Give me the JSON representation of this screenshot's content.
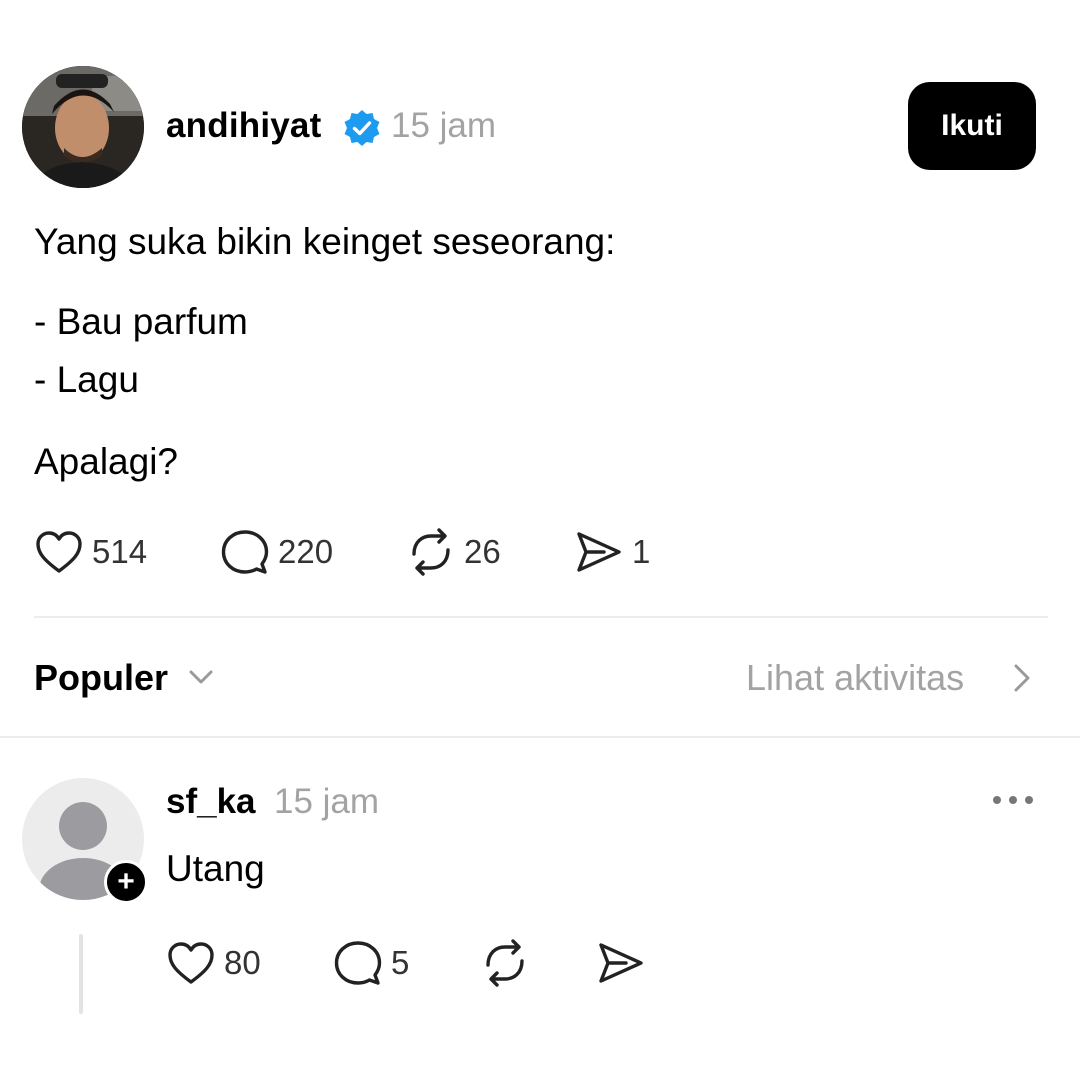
{
  "post": {
    "username": "andihiyat",
    "time": "15 jam",
    "follow_label": "Ikuti",
    "lines": [
      "Yang suka bikin keinget seseorang:",
      "- Bau parfum",
      "- Lagu",
      "Apalagi?"
    ],
    "actions": {
      "likes": "514",
      "replies": "220",
      "reposts": "26",
      "shares": "1"
    }
  },
  "replies_header": {
    "sort_label": "Populer",
    "activity_label": "Lihat aktivitas"
  },
  "reply": {
    "username": "sf_ka",
    "time": "15 jam",
    "text": "Utang",
    "actions": {
      "likes": "80",
      "replies": "5"
    }
  },
  "colors": {
    "verified_blue": "#1d9bf0",
    "muted_text": "#a3a3a3",
    "divider": "#ececec",
    "button_bg": "#000000"
  },
  "icons": [
    "verified-icon",
    "heart-icon",
    "comment-icon",
    "repost-icon",
    "share-icon",
    "chevron-down-icon",
    "chevron-right-icon",
    "more-icon",
    "plus-icon"
  ]
}
